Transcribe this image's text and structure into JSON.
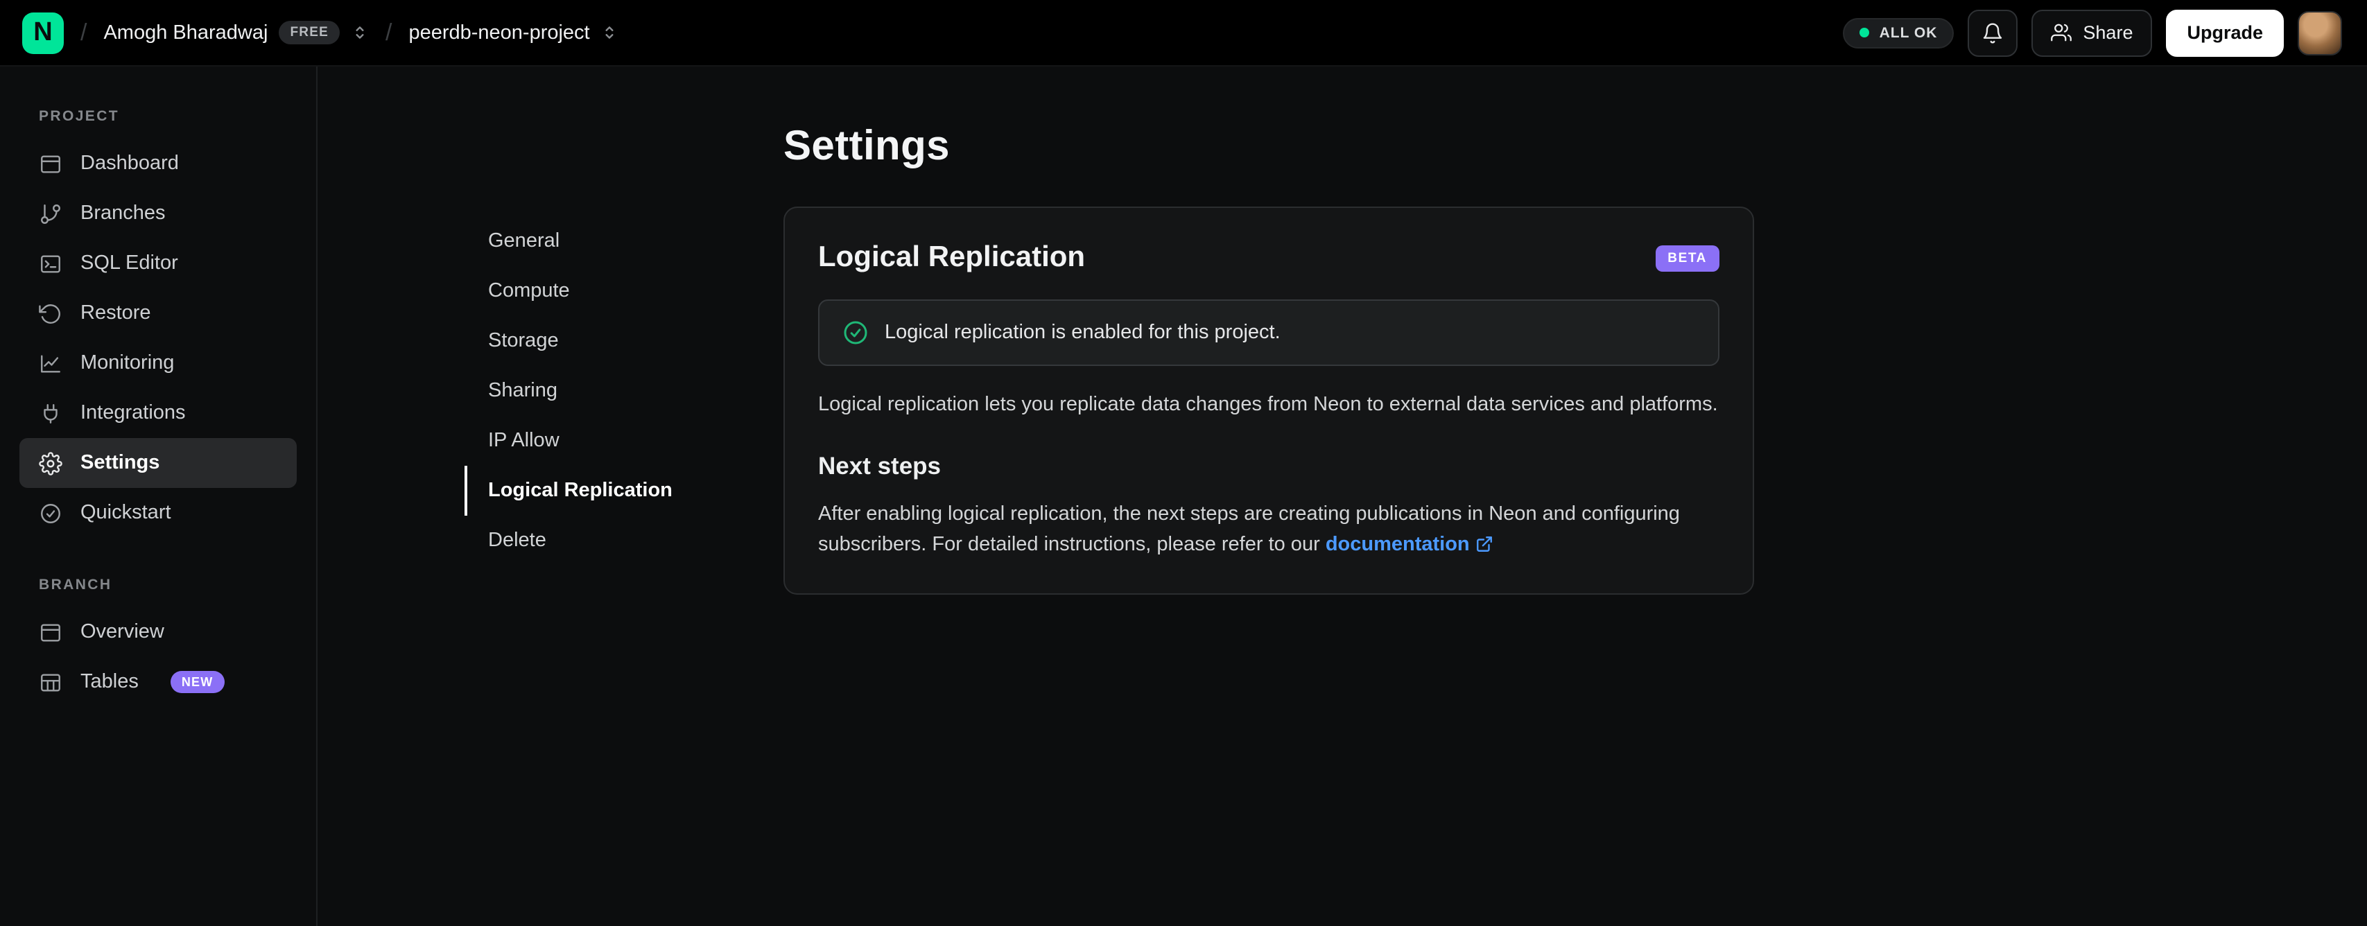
{
  "topbar": {
    "org": "Amogh Bharadwaj",
    "org_badge": "FREE",
    "project": "peerdb-neon-project",
    "status": "ALL OK",
    "share_label": "Share",
    "upgrade_label": "Upgrade",
    "logo_letter": "N"
  },
  "sidebar": {
    "sections": [
      {
        "label": "PROJECT",
        "items": [
          {
            "label": "Dashboard"
          },
          {
            "label": "Branches"
          },
          {
            "label": "SQL Editor"
          },
          {
            "label": "Restore"
          },
          {
            "label": "Monitoring"
          },
          {
            "label": "Integrations"
          },
          {
            "label": "Settings"
          },
          {
            "label": "Quickstart"
          }
        ]
      },
      {
        "label": "BRANCH",
        "items": [
          {
            "label": "Overview"
          },
          {
            "label": "Tables",
            "badge": "NEW"
          }
        ]
      }
    ]
  },
  "settings_nav": {
    "items": [
      "General",
      "Compute",
      "Storage",
      "Sharing",
      "IP Allow",
      "Logical Replication",
      "Delete"
    ],
    "active": "Logical Replication"
  },
  "main": {
    "title": "Settings",
    "card": {
      "title": "Logical Replication",
      "badge": "BETA",
      "alert": "Logical replication is enabled for this project.",
      "description": "Logical replication lets you replicate data changes from Neon to external data services and platforms.",
      "next_steps_title": "Next steps",
      "next_steps_text_before": "After enabling logical replication, the next steps are creating publications in Neon and configuring subscribers. For detailed instructions, please refer to our ",
      "link_label": "documentation"
    }
  },
  "colors": {
    "brand_green": "#00e599",
    "badge_purple": "#8b70f6",
    "link_blue": "#4c9aff",
    "success_green": "#1fb877"
  }
}
